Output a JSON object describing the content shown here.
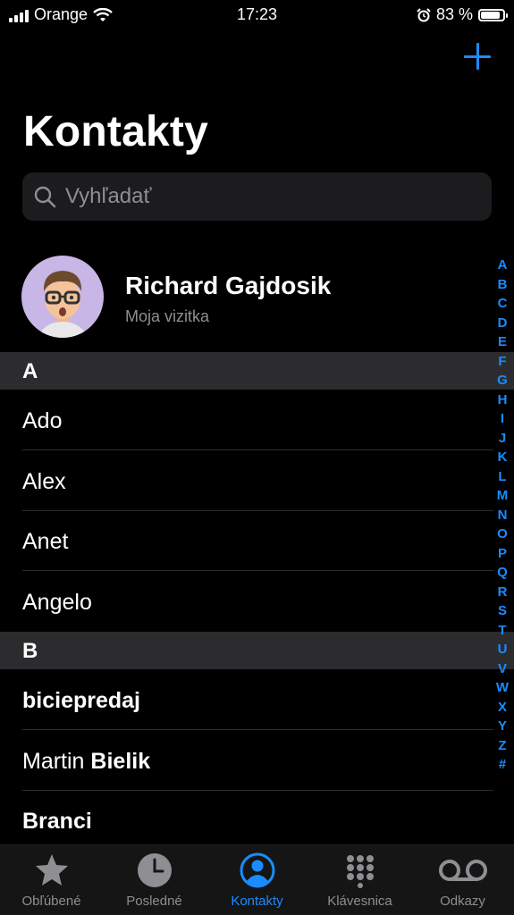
{
  "status": {
    "carrier": "Orange",
    "time": "17:23",
    "battery": "83 %",
    "battery_level": 0.83
  },
  "header": {
    "title": "Kontakty"
  },
  "search": {
    "placeholder": "Vyhľadať"
  },
  "my_card": {
    "name": "Richard Gajdosik",
    "subtitle": "Moja vizitka"
  },
  "sections": [
    {
      "letter": "A",
      "contacts": [
        {
          "first": "Ado",
          "last": ""
        },
        {
          "first": "Alex",
          "last": ""
        },
        {
          "first": "Anet",
          "last": ""
        },
        {
          "first": "Angelo",
          "last": ""
        }
      ]
    },
    {
      "letter": "B",
      "contacts": [
        {
          "first": "biciepredaj",
          "last": ""
        },
        {
          "first": "Martin",
          "last": "Bielik"
        },
        {
          "first": "Branci",
          "last": ""
        }
      ]
    }
  ],
  "index": [
    "A",
    "B",
    "C",
    "D",
    "E",
    "F",
    "G",
    "H",
    "I",
    "J",
    "K",
    "L",
    "M",
    "N",
    "O",
    "P",
    "Q",
    "R",
    "S",
    "T",
    "U",
    "V",
    "W",
    "X",
    "Y",
    "Z",
    "#"
  ],
  "tabs": [
    {
      "label": "Obľúbené",
      "icon": "star-icon",
      "active": false
    },
    {
      "label": "Posledné",
      "icon": "clock-icon",
      "active": false
    },
    {
      "label": "Kontakty",
      "icon": "person-circle-icon",
      "active": true
    },
    {
      "label": "Klávesnica",
      "icon": "keypad-icon",
      "active": false
    },
    {
      "label": "Odkazy",
      "icon": "voicemail-icon",
      "active": false
    }
  ],
  "colors": {
    "accent": "#1a8cff",
    "background": "#000000",
    "section_bg": "#2c2c2e"
  }
}
